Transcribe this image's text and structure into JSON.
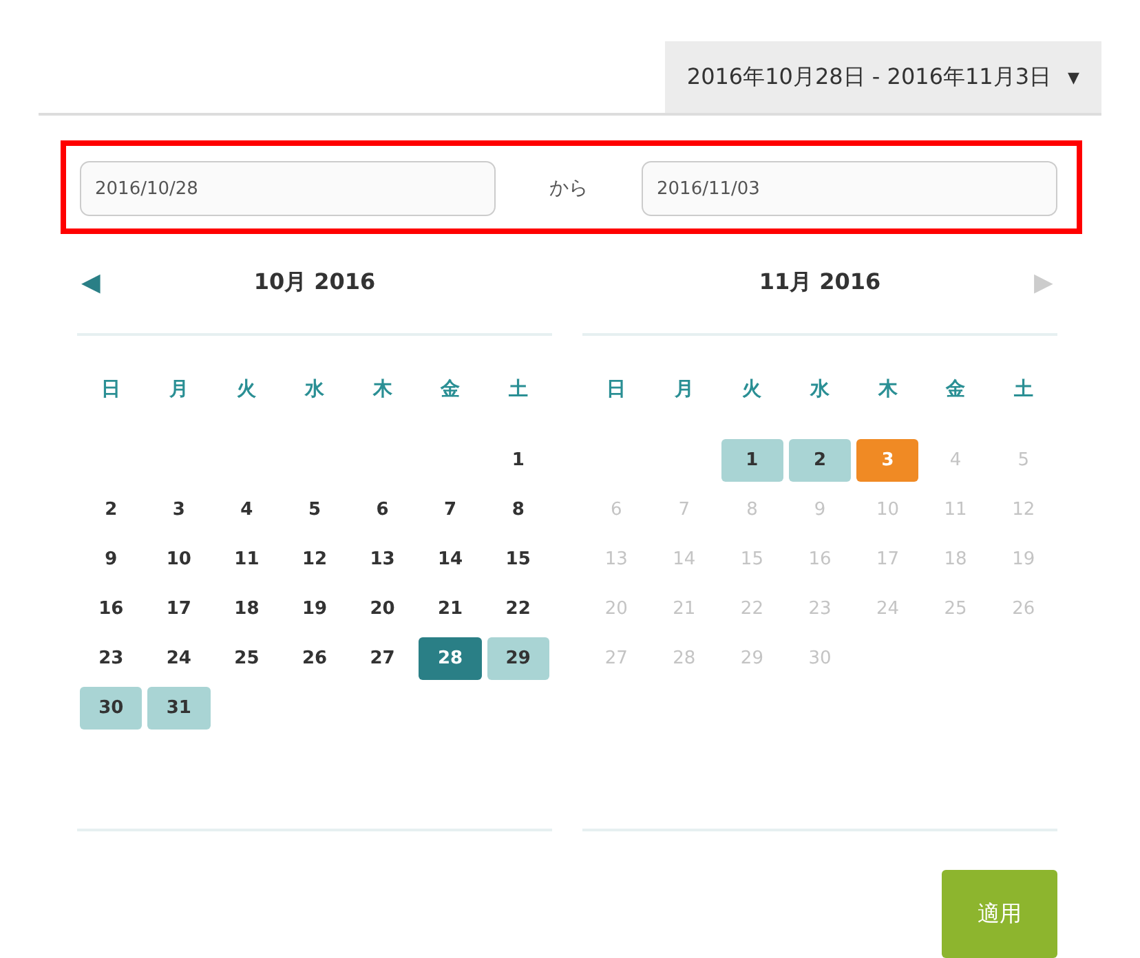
{
  "range_button": {
    "label": "2016年10月28日 - 2016年11月3日",
    "caret": "▼"
  },
  "range_inputs": {
    "highlighted": true,
    "from": {
      "value": "2016/10/28"
    },
    "separator": "から",
    "to": {
      "value": "2016/11/03"
    }
  },
  "nav": {
    "prev": "◀",
    "next": "▶",
    "prev_disabled": false,
    "next_disabled": true
  },
  "calendars": [
    {
      "title": "10月 2016",
      "weekdays": [
        "日",
        "月",
        "火",
        "水",
        "木",
        "金",
        "土"
      ],
      "weeks": [
        {
          "align_end": true,
          "days": [
            {
              "day": "1",
              "range_start": false,
              "range_end": false,
              "in_range": false,
              "disabled": false
            }
          ]
        },
        {
          "days": [
            {
              "day": "2",
              "range_start": false,
              "range_end": false,
              "in_range": false,
              "disabled": false
            },
            {
              "day": "3",
              "range_start": false,
              "range_end": false,
              "in_range": false,
              "disabled": false
            },
            {
              "day": "4",
              "range_start": false,
              "range_end": false,
              "in_range": false,
              "disabled": false
            },
            {
              "day": "5",
              "range_start": false,
              "range_end": false,
              "in_range": false,
              "disabled": false
            },
            {
              "day": "6",
              "range_start": false,
              "range_end": false,
              "in_range": false,
              "disabled": false
            },
            {
              "day": "7",
              "range_start": false,
              "range_end": false,
              "in_range": false,
              "disabled": false
            },
            {
              "day": "8",
              "range_start": false,
              "range_end": false,
              "in_range": false,
              "disabled": false
            }
          ]
        },
        {
          "days": [
            {
              "day": "9",
              "range_start": false,
              "range_end": false,
              "in_range": false,
              "disabled": false
            },
            {
              "day": "10",
              "range_start": false,
              "range_end": false,
              "in_range": false,
              "disabled": false
            },
            {
              "day": "11",
              "range_start": false,
              "range_end": false,
              "in_range": false,
              "disabled": false
            },
            {
              "day": "12",
              "range_start": false,
              "range_end": false,
              "in_range": false,
              "disabled": false
            },
            {
              "day": "13",
              "range_start": false,
              "range_end": false,
              "in_range": false,
              "disabled": false
            },
            {
              "day": "14",
              "range_start": false,
              "range_end": false,
              "in_range": false,
              "disabled": false
            },
            {
              "day": "15",
              "range_start": false,
              "range_end": false,
              "in_range": false,
              "disabled": false
            }
          ]
        },
        {
          "days": [
            {
              "day": "16",
              "range_start": false,
              "range_end": false,
              "in_range": false,
              "disabled": false
            },
            {
              "day": "17",
              "range_start": false,
              "range_end": false,
              "in_range": false,
              "disabled": false
            },
            {
              "day": "18",
              "range_start": false,
              "range_end": false,
              "in_range": false,
              "disabled": false
            },
            {
              "day": "19",
              "range_start": false,
              "range_end": false,
              "in_range": false,
              "disabled": false
            },
            {
              "day": "20",
              "range_start": false,
              "range_end": false,
              "in_range": false,
              "disabled": false
            },
            {
              "day": "21",
              "range_start": false,
              "range_end": false,
              "in_range": false,
              "disabled": false
            },
            {
              "day": "22",
              "range_start": false,
              "range_end": false,
              "in_range": false,
              "disabled": false
            }
          ]
        },
        {
          "days": [
            {
              "day": "23",
              "range_start": false,
              "range_end": false,
              "in_range": false,
              "disabled": false
            },
            {
              "day": "24",
              "range_start": false,
              "range_end": false,
              "in_range": false,
              "disabled": false
            },
            {
              "day": "25",
              "range_start": false,
              "range_end": false,
              "in_range": false,
              "disabled": false
            },
            {
              "day": "26",
              "range_start": false,
              "range_end": false,
              "in_range": false,
              "disabled": false
            },
            {
              "day": "27",
              "range_start": false,
              "range_end": false,
              "in_range": false,
              "disabled": false
            },
            {
              "day": "28",
              "range_start": true,
              "range_end": false,
              "in_range": false,
              "disabled": false
            },
            {
              "day": "29",
              "range_start": false,
              "range_end": false,
              "in_range": true,
              "disabled": false
            }
          ]
        },
        {
          "align_end": false,
          "days": [
            {
              "day": "30",
              "range_start": false,
              "range_end": false,
              "in_range": true,
              "disabled": false
            },
            {
              "day": "31",
              "range_start": false,
              "range_end": false,
              "in_range": true,
              "disabled": false
            }
          ]
        }
      ]
    },
    {
      "title": "11月 2016",
      "weekdays": [
        "日",
        "月",
        "火",
        "水",
        "木",
        "金",
        "土"
      ],
      "weeks": [
        {
          "align_end": true,
          "days": [
            {
              "day": "1",
              "range_start": false,
              "range_end": false,
              "in_range": true,
              "disabled": false
            },
            {
              "day": "2",
              "range_start": false,
              "range_end": false,
              "in_range": true,
              "disabled": false
            },
            {
              "day": "3",
              "range_start": false,
              "range_end": true,
              "in_range": false,
              "disabled": false
            },
            {
              "day": "4",
              "range_start": false,
              "range_end": false,
              "in_range": false,
              "disabled": true
            },
            {
              "day": "5",
              "range_start": false,
              "range_end": false,
              "in_range": false,
              "disabled": true
            }
          ]
        },
        {
          "days": [
            {
              "day": "6",
              "range_start": false,
              "range_end": false,
              "in_range": false,
              "disabled": true
            },
            {
              "day": "7",
              "range_start": false,
              "range_end": false,
              "in_range": false,
              "disabled": true
            },
            {
              "day": "8",
              "range_start": false,
              "range_end": false,
              "in_range": false,
              "disabled": true
            },
            {
              "day": "9",
              "range_start": false,
              "range_end": false,
              "in_range": false,
              "disabled": true
            },
            {
              "day": "10",
              "range_start": false,
              "range_end": false,
              "in_range": false,
              "disabled": true
            },
            {
              "day": "11",
              "range_start": false,
              "range_end": false,
              "in_range": false,
              "disabled": true
            },
            {
              "day": "12",
              "range_start": false,
              "range_end": false,
              "in_range": false,
              "disabled": true
            }
          ]
        },
        {
          "days": [
            {
              "day": "13",
              "range_start": false,
              "range_end": false,
              "in_range": false,
              "disabled": true
            },
            {
              "day": "14",
              "range_start": false,
              "range_end": false,
              "in_range": false,
              "disabled": true
            },
            {
              "day": "15",
              "range_start": false,
              "range_end": false,
              "in_range": false,
              "disabled": true
            },
            {
              "day": "16",
              "range_start": false,
              "range_end": false,
              "in_range": false,
              "disabled": true
            },
            {
              "day": "17",
              "range_start": false,
              "range_end": false,
              "in_range": false,
              "disabled": true
            },
            {
              "day": "18",
              "range_start": false,
              "range_end": false,
              "in_range": false,
              "disabled": true
            },
            {
              "day": "19",
              "range_start": false,
              "range_end": false,
              "in_range": false,
              "disabled": true
            }
          ]
        },
        {
          "days": [
            {
              "day": "20",
              "range_start": false,
              "range_end": false,
              "in_range": false,
              "disabled": true
            },
            {
              "day": "21",
              "range_start": false,
              "range_end": false,
              "in_range": false,
              "disabled": true
            },
            {
              "day": "22",
              "range_start": false,
              "range_end": false,
              "in_range": false,
              "disabled": true
            },
            {
              "day": "23",
              "range_start": false,
              "range_end": false,
              "in_range": false,
              "disabled": true
            },
            {
              "day": "24",
              "range_start": false,
              "range_end": false,
              "in_range": false,
              "disabled": true
            },
            {
              "day": "25",
              "range_start": false,
              "range_end": false,
              "in_range": false,
              "disabled": true
            },
            {
              "day": "26",
              "range_start": false,
              "range_end": false,
              "in_range": false,
              "disabled": true
            }
          ]
        },
        {
          "align_end": false,
          "days": [
            {
              "day": "27",
              "range_start": false,
              "range_end": false,
              "in_range": false,
              "disabled": true
            },
            {
              "day": "28",
              "range_start": false,
              "range_end": false,
              "in_range": false,
              "disabled": true
            },
            {
              "day": "29",
              "range_start": false,
              "range_end": false,
              "in_range": false,
              "disabled": true
            },
            {
              "day": "30",
              "range_start": false,
              "range_end": false,
              "in_range": false,
              "disabled": true
            }
          ]
        }
      ]
    }
  ],
  "apply_button": "適用"
}
